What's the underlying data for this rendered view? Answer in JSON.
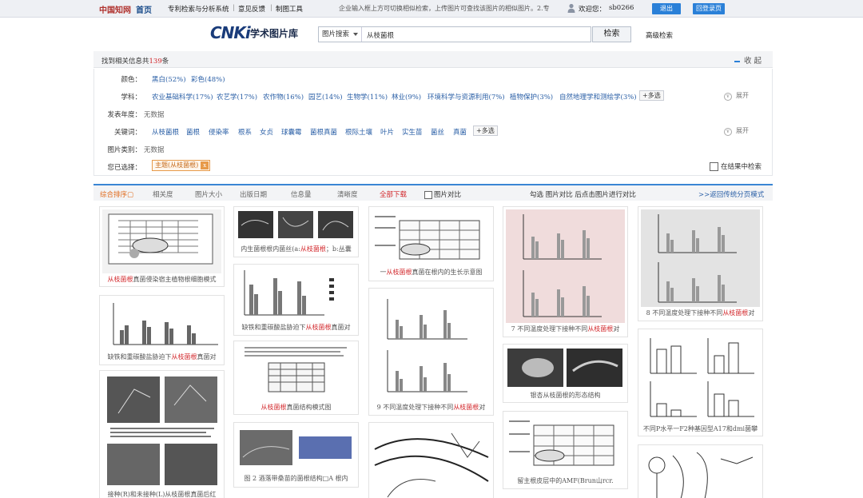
{
  "topbar": {
    "logo": "中国知网",
    "home": "首页",
    "nav": [
      "专利检索与分析系统",
      "意见反馈",
      "制图工具"
    ],
    "notice": "企业输入框上方可切换相似检索，上传图片可查找该图片的相似图片。2.专",
    "welcome": "欢迎您：",
    "username": "sb0266",
    "logout": "退出",
    "back": "回登录页"
  },
  "search": {
    "brand": "CNKi",
    "title": "学术图片库",
    "type": "图片搜索",
    "query": "从枝菌根",
    "button": "检索",
    "advanced": "高级检索"
  },
  "results": {
    "prefix": "找到相关信息共",
    "count": "139",
    "suffix": "条",
    "collapse": "收 起"
  },
  "filters": {
    "color": {
      "label": "颜色：",
      "items": [
        "黑白(52%)",
        "彩色(48%)"
      ]
    },
    "subject": {
      "label": "学科：",
      "items": [
        "农业基础科学(17%)",
        "农艺学(17%)",
        "农作物(16%)",
        "园艺(14%)",
        "生物学(11%)",
        "林业(9%)",
        "环境科学与资源利用(7%)",
        "植物保护(3%)",
        "自然地理学和测绘学(3%)"
      ],
      "multi": "+多选",
      "expand": "展开"
    },
    "year": {
      "label": "发表年度：",
      "value": "无数据"
    },
    "keyword": {
      "label": "关键词：",
      "items": [
        "从枝菌根",
        "菌根",
        "侵染率",
        "根系",
        "女贞",
        "球囊霉",
        "菌根真菌",
        "根际土壤",
        "叶片",
        "实生苗",
        "菌丝",
        "真菌"
      ],
      "multi": "+多选",
      "expand": "展开"
    },
    "category": {
      "label": "图片类别：",
      "value": "无数据"
    },
    "chosen": {
      "label": "您已选择：",
      "tag": "主题(从枝菌根)",
      "close": "x"
    },
    "within": "在结果中检索"
  },
  "sort": {
    "items": [
      "综合排序",
      "相关度",
      "图片大小",
      "出版日期",
      "信息量",
      "清晰度"
    ],
    "download": "全部下载",
    "compare": "图片对比",
    "hint": "勾选 图片对比 后点击图片进行对比",
    "back": ">>返回传统分页模式"
  },
  "cards": [
    {
      "pre": "",
      "hl": "从枝菌根",
      "post": "真菌侵染宿主植物根细胞模式"
    },
    {
      "pre": "缺铁和重碳酸盐胁迫下",
      "hl": "从枝菌根",
      "post": "真菌对"
    },
    {
      "pre": "接种(R)和未接种(L)从枝菌根真菌后红",
      "hl": "",
      "post": ""
    },
    {
      "pre": "内生菌根根内菌丝(a:",
      "hl": "从枝菌根",
      "post": "；b:丛囊"
    },
    {
      "pre": "缺铁和重碳酸盐胁迫下",
      "hl": "从枝菌根",
      "post": "真菌对"
    },
    {
      "pre": "",
      "hl": "从枝菌根",
      "post": "真菌结构模式图"
    },
    {
      "pre": "图 2 酒落带桑苗的菌根结构□A 根内",
      "hl": "",
      "post": ""
    },
    {
      "pre": "一",
      "hl": "从枝菌根",
      "post": "真菌在根内的生长示意图"
    },
    {
      "pre": "9 不同温度处理下接种不同",
      "hl": "从枝菌根",
      "post": "对"
    },
    {
      "pre": "7 不同温度处理下接种不同",
      "hl": "从枝菌根",
      "post": "对"
    },
    {
      "pre": "银杏从枝菌根的形态结构",
      "hl": "",
      "post": ""
    },
    {
      "pre": "留主根皮层中的AMF(Brun山rcr.",
      "hl": "",
      "post": ""
    },
    {
      "pre": "8 不同温度处理下接种不同",
      "hl": "从枝菌根",
      "post": "对"
    },
    {
      "pre": "不同P水平一F2种基因型A17和dmi菌攀",
      "hl": "",
      "post": ""
    }
  ]
}
